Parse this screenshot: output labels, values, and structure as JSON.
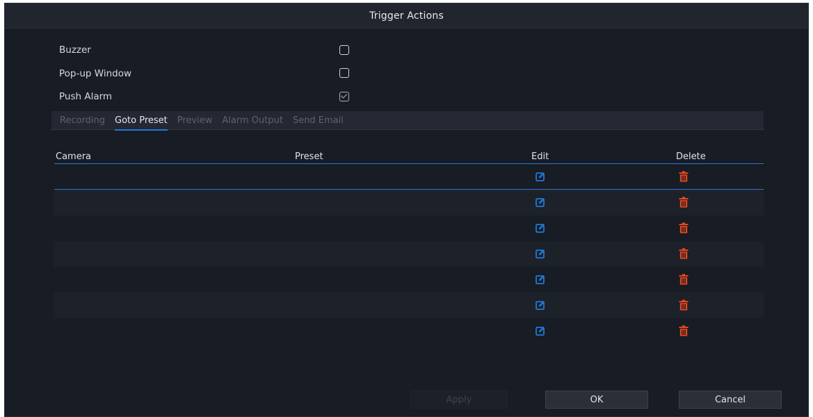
{
  "dialog": {
    "title": "Trigger Actions"
  },
  "options": [
    {
      "label": "Buzzer",
      "checked": false
    },
    {
      "label": "Pop-up Window",
      "checked": false
    },
    {
      "label": "Push Alarm",
      "checked": true
    }
  ],
  "tabs": [
    {
      "label": "Recording",
      "active": false
    },
    {
      "label": "Goto Preset",
      "active": true
    },
    {
      "label": "Preview",
      "active": false
    },
    {
      "label": "Alarm Output",
      "active": false
    },
    {
      "label": "Send Email",
      "active": false
    }
  ],
  "table": {
    "headers": {
      "camera": "Camera",
      "preset": "Preset",
      "edit": "Edit",
      "delete": "Delete"
    },
    "rows": [
      {
        "camera": "",
        "preset": ""
      },
      {
        "camera": "",
        "preset": ""
      },
      {
        "camera": "",
        "preset": ""
      },
      {
        "camera": "",
        "preset": ""
      },
      {
        "camera": "",
        "preset": ""
      },
      {
        "camera": "",
        "preset": ""
      },
      {
        "camera": "",
        "preset": ""
      }
    ]
  },
  "buttons": {
    "apply": "Apply",
    "ok": "OK",
    "cancel": "Cancel"
  },
  "icons": {
    "edit": "edit-icon",
    "delete": "trash-icon"
  },
  "colors": {
    "accent": "#1f7ad6",
    "delete": "#e8461e",
    "edit": "#1f7ad6",
    "background": "#181c24"
  }
}
